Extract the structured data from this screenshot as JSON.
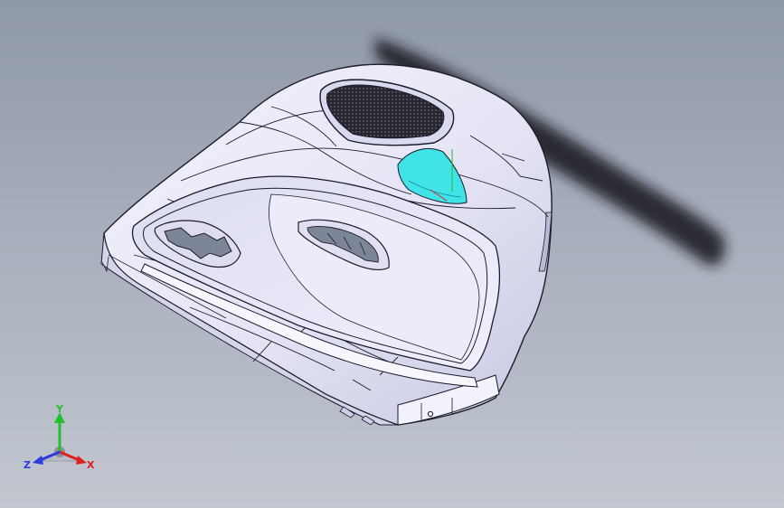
{
  "viewport": {
    "background_top": "#8f98a8",
    "background_bottom": "#c2c7d0"
  },
  "model": {
    "body_color": "#e8e8f7",
    "shade_color": "#c9c9e4",
    "edge_color": "#1b1b2a",
    "highlight_color": "#3fe3e8",
    "speaker_grille_color": "#2a2a32"
  },
  "triad": {
    "x_label": "X",
    "y_label": "Y",
    "z_label": "Z",
    "x_color": "#e02020",
    "y_color": "#22c02a",
    "z_color": "#2b3be0"
  }
}
